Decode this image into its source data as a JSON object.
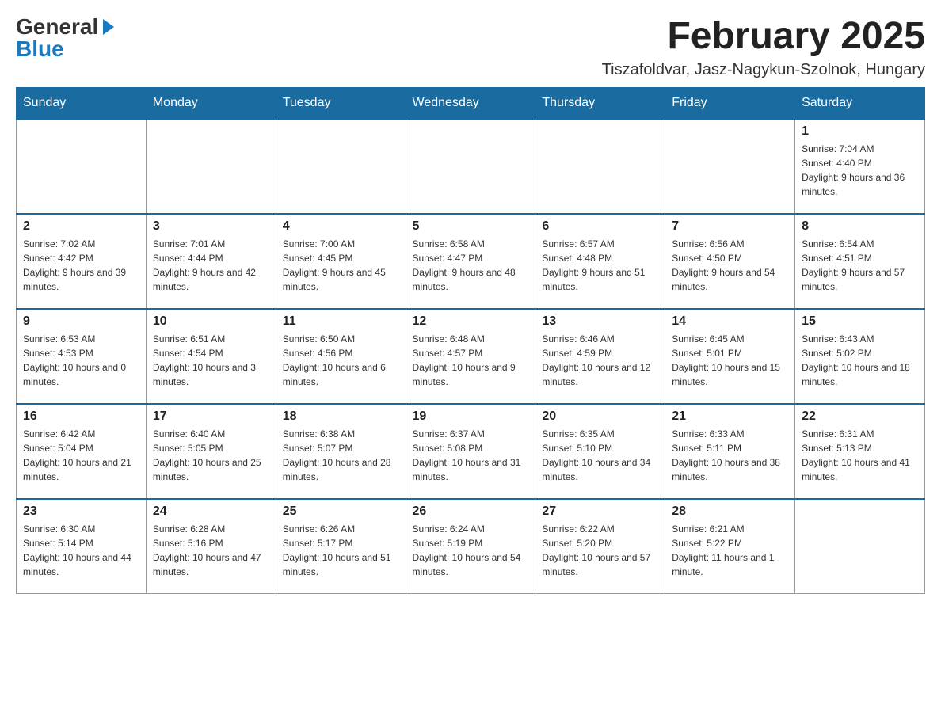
{
  "logo": {
    "general": "General",
    "blue": "Blue"
  },
  "title": {
    "month_year": "February 2025",
    "location": "Tiszafoldvar, Jasz-Nagykun-Szolnok, Hungary"
  },
  "days_of_week": [
    "Sunday",
    "Monday",
    "Tuesday",
    "Wednesday",
    "Thursday",
    "Friday",
    "Saturday"
  ],
  "weeks": [
    {
      "days": [
        {
          "date": "",
          "info": ""
        },
        {
          "date": "",
          "info": ""
        },
        {
          "date": "",
          "info": ""
        },
        {
          "date": "",
          "info": ""
        },
        {
          "date": "",
          "info": ""
        },
        {
          "date": "",
          "info": ""
        },
        {
          "date": "1",
          "info": "Sunrise: 7:04 AM\nSunset: 4:40 PM\nDaylight: 9 hours and 36 minutes."
        }
      ]
    },
    {
      "days": [
        {
          "date": "2",
          "info": "Sunrise: 7:02 AM\nSunset: 4:42 PM\nDaylight: 9 hours and 39 minutes."
        },
        {
          "date": "3",
          "info": "Sunrise: 7:01 AM\nSunset: 4:44 PM\nDaylight: 9 hours and 42 minutes."
        },
        {
          "date": "4",
          "info": "Sunrise: 7:00 AM\nSunset: 4:45 PM\nDaylight: 9 hours and 45 minutes."
        },
        {
          "date": "5",
          "info": "Sunrise: 6:58 AM\nSunset: 4:47 PM\nDaylight: 9 hours and 48 minutes."
        },
        {
          "date": "6",
          "info": "Sunrise: 6:57 AM\nSunset: 4:48 PM\nDaylight: 9 hours and 51 minutes."
        },
        {
          "date": "7",
          "info": "Sunrise: 6:56 AM\nSunset: 4:50 PM\nDaylight: 9 hours and 54 minutes."
        },
        {
          "date": "8",
          "info": "Sunrise: 6:54 AM\nSunset: 4:51 PM\nDaylight: 9 hours and 57 minutes."
        }
      ]
    },
    {
      "days": [
        {
          "date": "9",
          "info": "Sunrise: 6:53 AM\nSunset: 4:53 PM\nDaylight: 10 hours and 0 minutes."
        },
        {
          "date": "10",
          "info": "Sunrise: 6:51 AM\nSunset: 4:54 PM\nDaylight: 10 hours and 3 minutes."
        },
        {
          "date": "11",
          "info": "Sunrise: 6:50 AM\nSunset: 4:56 PM\nDaylight: 10 hours and 6 minutes."
        },
        {
          "date": "12",
          "info": "Sunrise: 6:48 AM\nSunset: 4:57 PM\nDaylight: 10 hours and 9 minutes."
        },
        {
          "date": "13",
          "info": "Sunrise: 6:46 AM\nSunset: 4:59 PM\nDaylight: 10 hours and 12 minutes."
        },
        {
          "date": "14",
          "info": "Sunrise: 6:45 AM\nSunset: 5:01 PM\nDaylight: 10 hours and 15 minutes."
        },
        {
          "date": "15",
          "info": "Sunrise: 6:43 AM\nSunset: 5:02 PM\nDaylight: 10 hours and 18 minutes."
        }
      ]
    },
    {
      "days": [
        {
          "date": "16",
          "info": "Sunrise: 6:42 AM\nSunset: 5:04 PM\nDaylight: 10 hours and 21 minutes."
        },
        {
          "date": "17",
          "info": "Sunrise: 6:40 AM\nSunset: 5:05 PM\nDaylight: 10 hours and 25 minutes."
        },
        {
          "date": "18",
          "info": "Sunrise: 6:38 AM\nSunset: 5:07 PM\nDaylight: 10 hours and 28 minutes."
        },
        {
          "date": "19",
          "info": "Sunrise: 6:37 AM\nSunset: 5:08 PM\nDaylight: 10 hours and 31 minutes."
        },
        {
          "date": "20",
          "info": "Sunrise: 6:35 AM\nSunset: 5:10 PM\nDaylight: 10 hours and 34 minutes."
        },
        {
          "date": "21",
          "info": "Sunrise: 6:33 AM\nSunset: 5:11 PM\nDaylight: 10 hours and 38 minutes."
        },
        {
          "date": "22",
          "info": "Sunrise: 6:31 AM\nSunset: 5:13 PM\nDaylight: 10 hours and 41 minutes."
        }
      ]
    },
    {
      "days": [
        {
          "date": "23",
          "info": "Sunrise: 6:30 AM\nSunset: 5:14 PM\nDaylight: 10 hours and 44 minutes."
        },
        {
          "date": "24",
          "info": "Sunrise: 6:28 AM\nSunset: 5:16 PM\nDaylight: 10 hours and 47 minutes."
        },
        {
          "date": "25",
          "info": "Sunrise: 6:26 AM\nSunset: 5:17 PM\nDaylight: 10 hours and 51 minutes."
        },
        {
          "date": "26",
          "info": "Sunrise: 6:24 AM\nSunset: 5:19 PM\nDaylight: 10 hours and 54 minutes."
        },
        {
          "date": "27",
          "info": "Sunrise: 6:22 AM\nSunset: 5:20 PM\nDaylight: 10 hours and 57 minutes."
        },
        {
          "date": "28",
          "info": "Sunrise: 6:21 AM\nSunset: 5:22 PM\nDaylight: 11 hours and 1 minute."
        },
        {
          "date": "",
          "info": ""
        }
      ]
    }
  ]
}
